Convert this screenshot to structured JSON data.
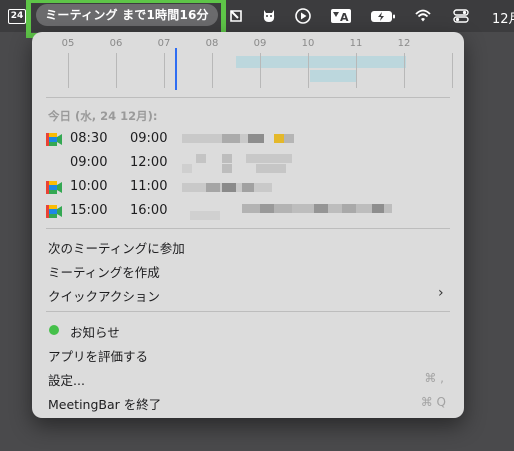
{
  "menubar": {
    "calendar_day": "24",
    "meeting_pill": "ミーティング まで1時間16分",
    "clock": "12月",
    "status_icons": [
      "window-icon",
      "cat-icon",
      "play-circle-icon",
      "input-a-icon",
      "battery-charging-icon",
      "wifi-icon",
      "control-center-icon"
    ]
  },
  "timeline": {
    "hours": [
      "05",
      "06",
      "07",
      "08",
      "09",
      "10",
      "11",
      "12"
    ]
  },
  "events_section": {
    "date_header": "今日 (水, 24 12月):",
    "events": [
      {
        "start": "08:30",
        "end": "09:00",
        "has_meet_icon": true
      },
      {
        "start": "09:00",
        "end": "12:00",
        "has_meet_icon": false
      },
      {
        "start": "10:00",
        "end": "11:00",
        "has_meet_icon": true
      },
      {
        "start": "15:00",
        "end": "16:00",
        "has_meet_icon": true
      }
    ]
  },
  "menu": {
    "join_next": "次のミーティングに参加",
    "create_meeting": "ミーティングを作成",
    "quick_actions": "クイックアクション",
    "notifications": "お知らせ",
    "rate_app": "アプリを評価する",
    "settings": "設定...",
    "settings_shortcut": "⌘ ,",
    "quit": "MeetingBar を終了",
    "quit_shortcut": "⌘ Q"
  },
  "colors": {
    "highlight_border": "#5ec548",
    "now_indicator": "#2f6df2",
    "status_dot": "#45c04a",
    "timeline_block": "#bcd7dd"
  }
}
